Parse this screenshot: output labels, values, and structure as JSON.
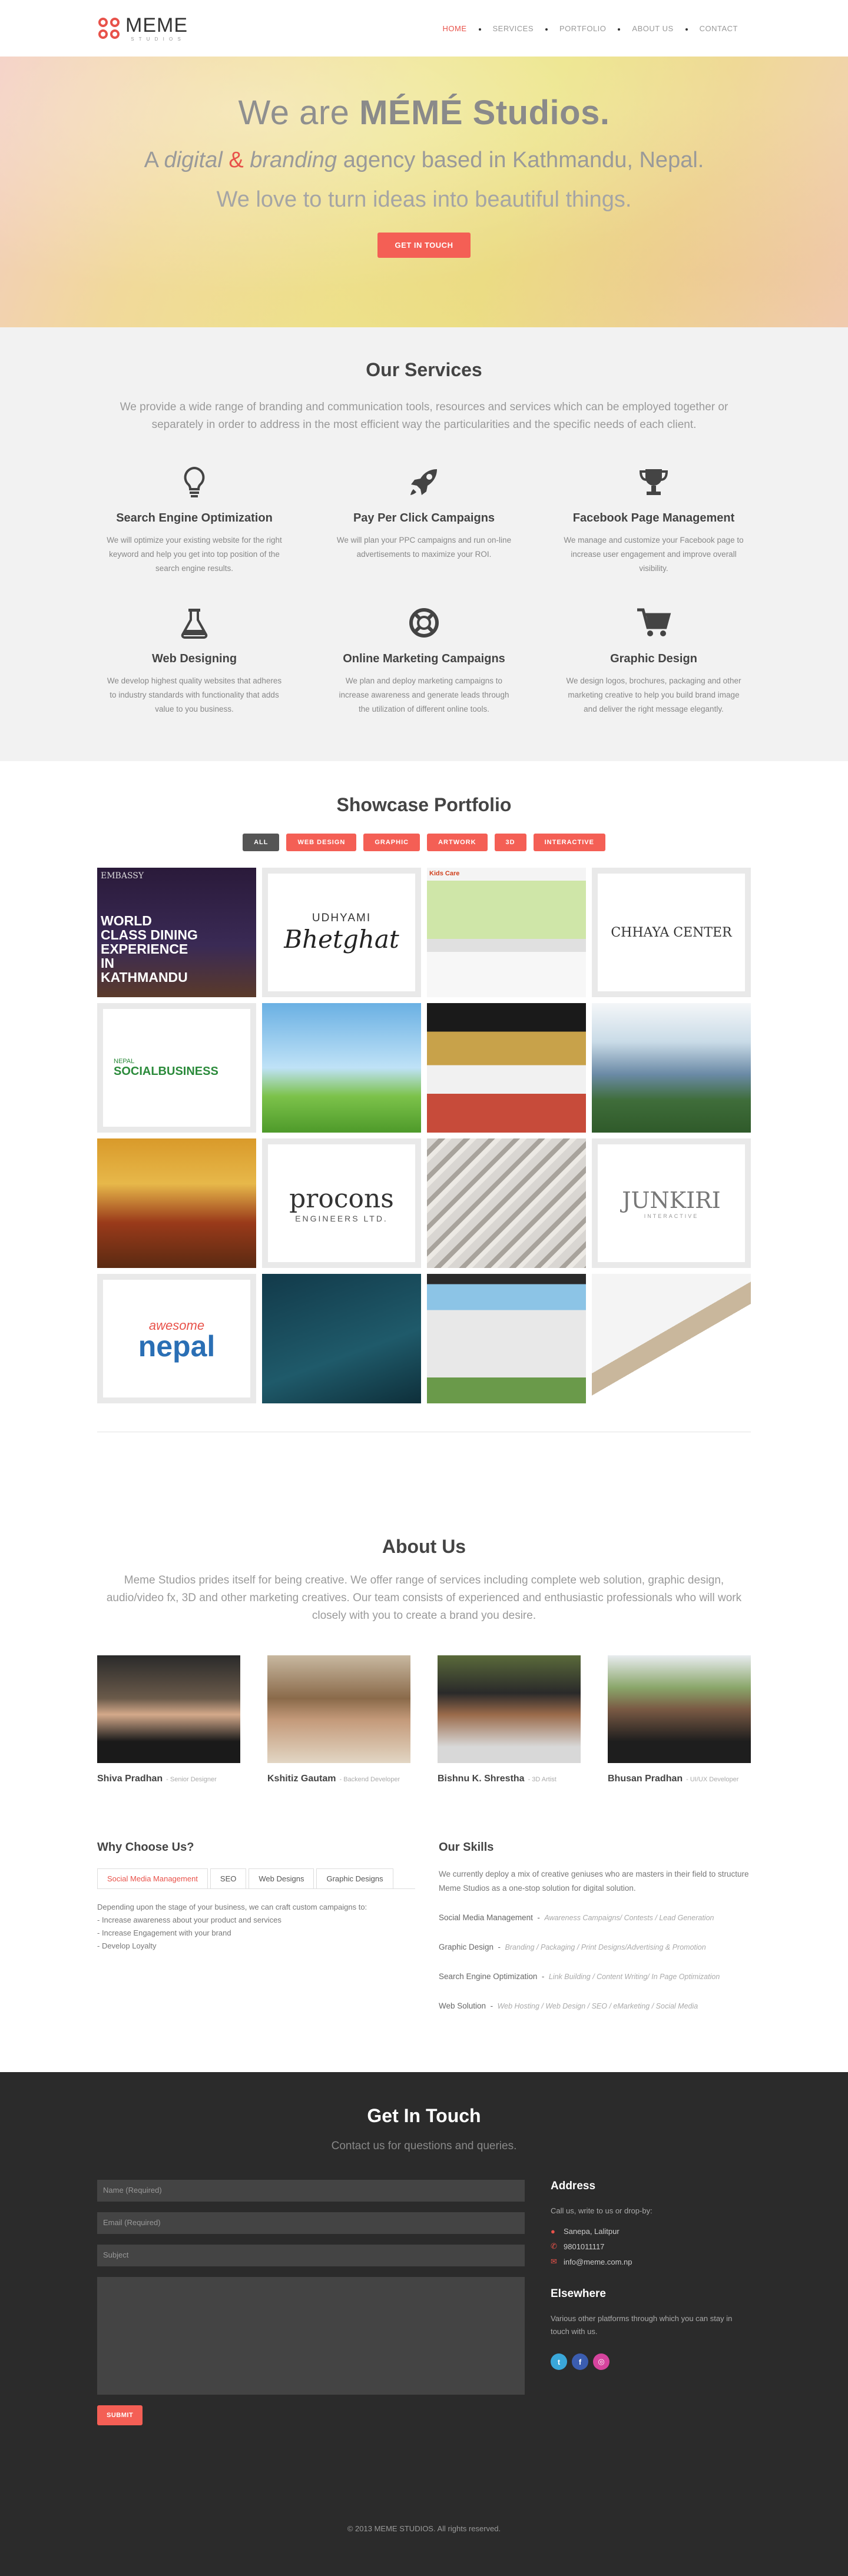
{
  "brand": {
    "name": "MEME",
    "sub": "S T U D I O S",
    "accent": "#e8524a"
  },
  "nav": [
    {
      "label": "HOME",
      "active": true
    },
    {
      "label": "SERVICES",
      "active": false
    },
    {
      "label": "PORTFOLIO",
      "active": false
    },
    {
      "label": "ABOUT US",
      "active": false
    },
    {
      "label": "CONTACT",
      "active": false
    }
  ],
  "hero": {
    "title_pre": "We are ",
    "title_brand": "MÉMÉ Studios.",
    "line2_a": "A ",
    "line2_b": "digital",
    "line2_amp": " & ",
    "line2_c": "branding",
    "line2_d": " agency based in Kathmandu, Nepal.",
    "line3": "We love to turn ideas into beautiful things.",
    "cta": "GET IN TOUCH"
  },
  "services": {
    "title": "Our Services",
    "intro": "We provide a wide range of branding and communication tools, resources and services which can be employed together or separately in order to address in the most efficient way the particularities and the specific needs of each client.",
    "items": [
      {
        "icon": "lightbulb-icon",
        "title": "Search Engine Optimization",
        "text": "We will optimize your existing website for the right keyword and help you get into top position of the search engine results."
      },
      {
        "icon": "rocket-icon",
        "title": "Pay Per Click Campaigns",
        "text": "We will plan your PPC campaigns and run on-line advertisements to maximize your ROI."
      },
      {
        "icon": "trophy-icon",
        "title": "Facebook Page Management",
        "text": "We manage and customize your Facebook page to increase user engagement and improve overall visibility."
      },
      {
        "icon": "flask-icon",
        "title": "Web Designing",
        "text": "We develop highest quality websites that adheres to industry standards with functionality that adds value to you business."
      },
      {
        "icon": "lifebuoy-icon",
        "title": "Online Marketing Campaigns",
        "text": "We plan and deploy marketing campaigns to increase awareness and generate leads through the utilization of different online tools."
      },
      {
        "icon": "cart-icon",
        "title": "Graphic Design",
        "text": "We design logos, brochures, packaging and other marketing creative to help you build brand image and deliver the right message elegantly."
      }
    ]
  },
  "portfolio": {
    "title": "Showcase Portfolio",
    "filters": [
      "ALL",
      "WEB DESIGN",
      "GRAPHIC",
      "ARTWORK",
      "3D",
      "INTERACTIVE"
    ],
    "tiles": [
      {
        "label": "EMBASSY",
        "caption": "WORLD CLASS DINING EXPERIENCE IN KATHMANDU"
      },
      {
        "label": "UDHYAMI",
        "caption": "Bhetghat"
      },
      {
        "label": "Kids Care",
        "caption": ""
      },
      {
        "label": "CHHAYA CENTER",
        "caption": ""
      },
      {
        "label": "NEPAL",
        "caption": "SOCIALBUSINESS"
      },
      {
        "label": "",
        "caption": ""
      },
      {
        "label": "",
        "caption": ""
      },
      {
        "label": "",
        "caption": ""
      },
      {
        "label": "",
        "caption": ""
      },
      {
        "label": "procons",
        "caption": "ENGINEERS LTD."
      },
      {
        "label": "",
        "caption": ""
      },
      {
        "label": "JUNKIRI",
        "caption": "INTERACTIVE"
      },
      {
        "label": "awesome",
        "caption": "nepal"
      },
      {
        "label": "",
        "caption": ""
      },
      {
        "label": "",
        "caption": ""
      },
      {
        "label": "",
        "caption": ""
      }
    ]
  },
  "about": {
    "title": "About Us",
    "intro": "Meme Studios prides itself for being creative. We offer range of services including complete web solution, graphic design, audio/video fx, 3D and other marketing creatives. Our team consists of experienced and enthusiastic professionals who will work closely with you to create a brand you desire.",
    "team": [
      {
        "name": "Shiva Pradhan",
        "role": "- Senior Designer"
      },
      {
        "name": "Kshitiz Gautam",
        "role": "- Backend Developer"
      },
      {
        "name": "Bishnu K. Shrestha",
        "role": "- 3D Artist"
      },
      {
        "name": "Bhusan Pradhan",
        "role": "- UI/UX Developer"
      }
    ]
  },
  "why": {
    "title": "Why Choose Us?",
    "tabs": [
      "Social Media Management",
      "SEO",
      "Web Designs",
      "Graphic Designs"
    ],
    "intro": "Depending upon the stage of your business, we can craft custom campaigns to:",
    "points": [
      "- Increase awareness about your product and services",
      "- Increase Engagement with your brand",
      "- Develop Loyalty"
    ]
  },
  "skills": {
    "title": "Our Skills",
    "intro": "We currently deploy a mix of creative geniuses who are masters in their field to structure Meme Studios as a one-stop solution for digital solution.",
    "items": [
      {
        "name": "Social Media Management",
        "detail": "Awareness Campaigns/ Contests / Lead Generation"
      },
      {
        "name": "Graphic Design",
        "detail": "Branding / Packaging / Print Designs/Advertising & Promotion"
      },
      {
        "name": "Search Engine Optimization",
        "detail": "Link Building / Content Writing/ In Page Optimization"
      },
      {
        "name": "Web Solution",
        "detail": "Web Hosting / Web Design / SEO / eMarketing / Social Media"
      }
    ]
  },
  "contact": {
    "title": "Get In Touch",
    "sub": "Contact us for questions and queries.",
    "name_ph": "Name (Required)",
    "email_ph": "Email (Required)",
    "subject_ph": "Subject",
    "submit": "SUBMIT",
    "address_title": "Address",
    "address_intro": "Call us, write to us or drop-by:",
    "location": "Sanepa, Lalitpur",
    "phone": "9801011117",
    "email": "info@meme.com.np",
    "elsewhere_title": "Elsewhere",
    "elsewhere_text": "Various other platforms through which you can stay in touch with us.",
    "social": [
      {
        "icon": "twitter-icon",
        "glyph": "t",
        "color": "#3aa7d9"
      },
      {
        "icon": "facebook-icon",
        "glyph": "f",
        "color": "#3b5db0"
      },
      {
        "icon": "instagram-icon",
        "glyph": "◎",
        "color": "#d6449e"
      }
    ]
  },
  "footer": {
    "text": "© 2013 MEME STUDIOS. All rights reserved."
  }
}
